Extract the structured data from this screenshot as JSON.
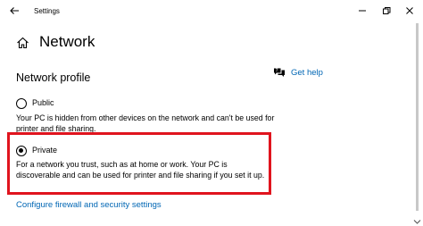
{
  "window": {
    "title": "Settings"
  },
  "header": {
    "title": "Network"
  },
  "section": {
    "title": "Network profile"
  },
  "help": {
    "label": "Get help"
  },
  "profiles": {
    "public": {
      "label": "Public",
      "description": "Your PC is hidden from other devices on the network and can't be used for printer and file sharing.",
      "selected": false
    },
    "private": {
      "label": "Private",
      "description": "For a network you trust, such as at home or work. Your PC is discoverable and can be used for printer and file sharing if you set it up.",
      "selected": true
    }
  },
  "links": {
    "firewall": "Configure firewall and security settings"
  },
  "icons": {
    "back": "back-arrow-icon",
    "home": "home-icon",
    "help": "chat-help-icon",
    "minimize": "minimize-icon",
    "maximize": "restore-icon",
    "close": "close-icon"
  },
  "colors": {
    "accent": "#0066b4",
    "highlight": "#e0141e"
  }
}
